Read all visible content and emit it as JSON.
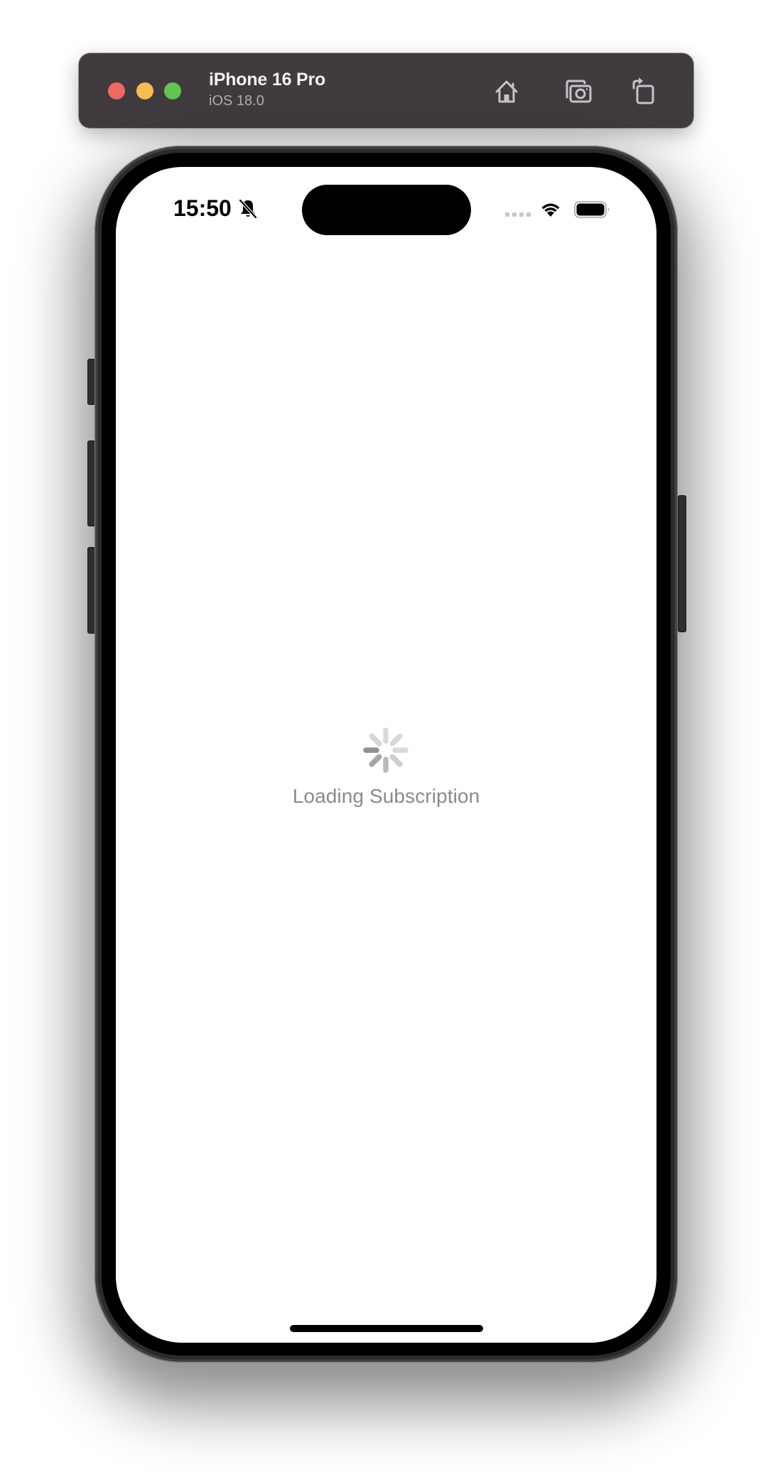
{
  "simulator": {
    "device_name": "iPhone 16 Pro",
    "os_version": "iOS 18.0",
    "window_controls": [
      "close",
      "minimize",
      "zoom"
    ],
    "toolbar_icons": [
      "home-icon",
      "screenshot-icon",
      "rotate-icon"
    ],
    "colors": {
      "titlebar": "#403b3f",
      "close": "#ee6a5f",
      "minimize": "#f5be4f",
      "zoom": "#62c554"
    }
  },
  "status_bar": {
    "time": "15:50",
    "silent_mode": true,
    "icons": [
      "bell-slash-icon",
      "signal-icon",
      "wifi-icon",
      "battery-icon"
    ],
    "battery_level": 1.0
  },
  "screen": {
    "loading_text": "Loading Subscription",
    "spinner": "activity-indicator"
  }
}
